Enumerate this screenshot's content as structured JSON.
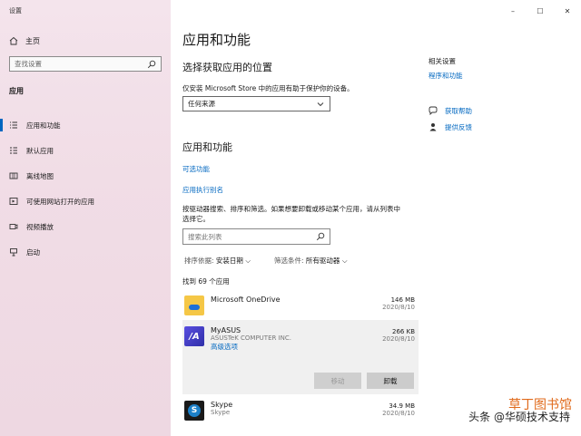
{
  "window": {
    "title": "设置",
    "controls": [
      "–",
      "☐",
      "✕"
    ]
  },
  "sidebar": {
    "home_label": "主页",
    "search_placeholder": "查找设置",
    "section_title": "应用",
    "items": [
      {
        "label": "应用和功能",
        "icon": "list-icon",
        "active": true
      },
      {
        "label": "默认应用",
        "icon": "default-apps-icon"
      },
      {
        "label": "离线地图",
        "icon": "map-icon"
      },
      {
        "label": "可使用网站打开的应用",
        "icon": "web-app-icon"
      },
      {
        "label": "视频播放",
        "icon": "video-icon"
      },
      {
        "label": "启动",
        "icon": "startup-icon"
      }
    ]
  },
  "main": {
    "title": "应用和功能",
    "choose_heading": "选择获取应用的位置",
    "choose_desc": "仅安装 Microsoft Store 中的应用有助于保护你的设备。",
    "source_value": "任何来源",
    "apps_heading": "应用和功能",
    "optional_features": "可选功能",
    "app_alias": "应用执行别名",
    "search_desc_line1": "按驱动器搜索、排序和筛选。如果想要卸载或移动某个应用，请从列表中",
    "search_desc_line2": "选择它。",
    "list_search_placeholder": "搜索此列表",
    "sort_label": "排序依据:",
    "sort_value": "安装日期",
    "filter_label": "筛选条件:",
    "filter_value": "所有驱动器",
    "found_count": "找到 69 个应用",
    "apps": [
      {
        "name": "Microsoft OneDrive",
        "publisher": "",
        "size": "146 MB",
        "date": "2020/8/10",
        "color": "#f2c14e"
      },
      {
        "name": "MyASUS",
        "publisher": "ASUSTeK COMPUTER INC.",
        "size": "266 KB",
        "date": "2020/8/10",
        "color": "#4b4bd8",
        "advanced": "高级选项",
        "move": "移动",
        "uninstall": "卸载"
      },
      {
        "name": "Skype",
        "publisher": "Skype",
        "size": "34.9 MB",
        "date": "2020/8/10",
        "color": "#1c80c8"
      }
    ]
  },
  "related": {
    "title": "相关设置",
    "program_features": "程序和功能",
    "get_help": "获取帮助",
    "give_feedback": "提供反馈"
  },
  "watermark": {
    "text": "头条 @华硕技术支持",
    "brand": "草丁图书馆"
  }
}
